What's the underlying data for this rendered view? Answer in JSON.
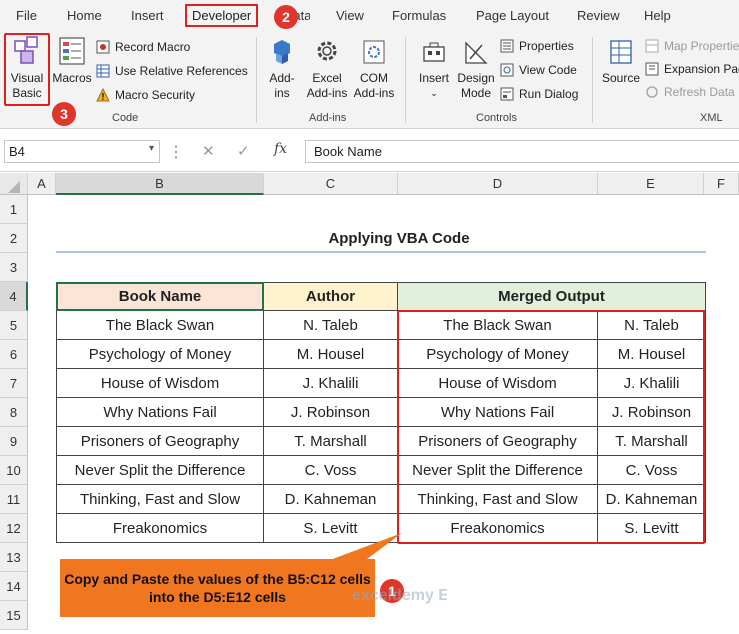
{
  "ribbon_tabs": [
    "File",
    "Home",
    "Insert",
    "Developer",
    "Data",
    "View",
    "Formulas",
    "Page Layout",
    "Review",
    "Help"
  ],
  "code_group": {
    "visual_basic": "Visual Basic",
    "macros": "Macros",
    "record_macro": "Record Macro",
    "use_relative": "Use Relative References",
    "macro_security": "Macro Security",
    "label": "Code"
  },
  "addins_group": {
    "addins": "Add-ins",
    "excel_addins": "Excel Add-ins",
    "com_addins": "COM Add-ins",
    "label": "Add-ins"
  },
  "controls_group": {
    "insert": "Insert",
    "design_mode": "Design Mode",
    "properties": "Properties",
    "view_code": "View Code",
    "run_dialog": "Run Dialog",
    "label": "Controls"
  },
  "xml_group": {
    "source": "Source",
    "map_properties": "Map Properties",
    "expansion_packs": "Expansion Packs",
    "refresh_data": "Refresh Data",
    "label": "XML"
  },
  "badges": [
    "1",
    "2",
    "3"
  ],
  "formula_bar": {
    "name_box": "B4",
    "fx": "fx",
    "content": "Book Name"
  },
  "columns": [
    "A",
    "B",
    "C",
    "D",
    "E",
    "F"
  ],
  "rows": [
    "1",
    "2",
    "3",
    "4",
    "5",
    "6",
    "7",
    "8",
    "9",
    "10",
    "11",
    "12",
    "13",
    "14",
    "15"
  ],
  "sheet": {
    "title": "Applying VBA Code",
    "headers": {
      "book": "Book Name",
      "author": "Author",
      "merged": "Merged Output"
    },
    "records": [
      {
        "book": "The Black Swan",
        "author": "N. Taleb"
      },
      {
        "book": "Psychology of Money",
        "author": "M. Housel"
      },
      {
        "book": "House of Wisdom",
        "author": "J. Khalili"
      },
      {
        "book": "Why Nations Fail",
        "author": "J. Robinson"
      },
      {
        "book": "Prisoners of Geography",
        "author": "T. Marshall"
      },
      {
        "book": "Never Split the Difference",
        "author": "C. Voss"
      },
      {
        "book": "Thinking, Fast and Slow",
        "author": "D. Kahneman"
      },
      {
        "book": "Freakonomics",
        "author": "S. Levitt"
      }
    ]
  },
  "callout": "Copy and Paste the values of the B5:C12 cells into the D5:E12 cells",
  "watermark": "exceldemy EXCEL · DATA · BI",
  "colors": {
    "book_header": "#fce4d6",
    "author_header": "#fff2cc",
    "merged_header": "#e2efda",
    "accent_red": "#e02020",
    "callout": "#f07620"
  }
}
